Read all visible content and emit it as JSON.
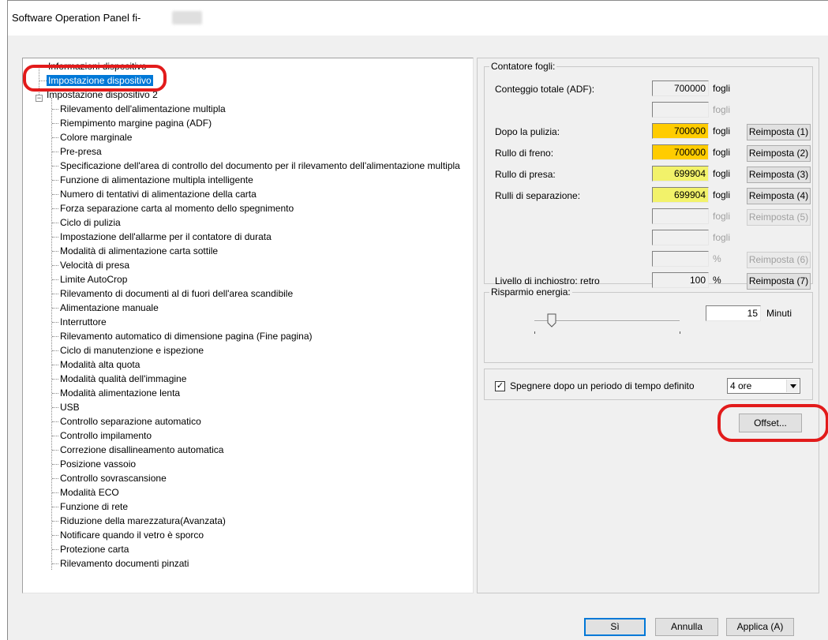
{
  "window": {
    "title": "Software Operation Panel fi-"
  },
  "tree": {
    "root_items": [
      {
        "label": "Informazioni dispositivo",
        "selected": false
      },
      {
        "label": "Impostazione dispositivo",
        "selected": true
      },
      {
        "label": "Impostazione dispositivo 2",
        "selected": false,
        "expander": "−"
      }
    ],
    "children": [
      "Rilevamento dell'alimentazione multipla",
      "Riempimento margine pagina (ADF)",
      "Colore marginale",
      "Pre-presa",
      "Specificazione dell'area di controllo del documento per il rilevamento dell'alimentazione multipla",
      "Funzione di alimentazione multipla intelligente",
      "Numero di tentativi di alimentazione della carta",
      "Forza separazione carta al momento dello spegnimento",
      "Ciclo di pulizia",
      "Impostazione dell'allarme per il contatore di durata",
      "Modalità di alimentazione carta sottile",
      "Velocità di presa",
      "Limite AutoCrop",
      "Rilevamento di documenti al di fuori dell'area scandibile",
      "Alimentazione manuale",
      "Interruttore",
      "Rilevamento automatico di dimensione pagina (Fine pagina)",
      "Ciclo di manutenzione e ispezione",
      "Modalità alta quota",
      "Modalità qualità dell'immagine",
      "Modalità alimentazione lenta",
      "USB",
      "Controllo separazione automatico",
      "Controllo impilamento",
      "Correzione disallineamento automatica",
      "Posizione vassoio",
      "Controllo sovrascansione",
      "Modalità ECO",
      "Funzione di rete",
      "Riduzione della marezzatura(Avanzata)",
      "Notificare quando il vetro è sporco",
      "Protezione carta",
      "Rilevamento documenti pinzati"
    ]
  },
  "counter": {
    "legend": "Contatore fogli:",
    "rows": [
      {
        "label": "Conteggio totale (ADF):",
        "value": "700000",
        "unit": "fogli",
        "button": "",
        "color": "#f0f0f0",
        "unit_disabled": false,
        "btn_disabled": false
      },
      {
        "label": "",
        "value": "",
        "unit": "fogli",
        "button": "",
        "color": "#f0f0f0",
        "unit_disabled": true,
        "btn_disabled": false
      },
      {
        "label": "Dopo la pulizia:",
        "value": "700000",
        "unit": "fogli",
        "button": "Reimposta (1)",
        "color": "#ffcc00",
        "unit_disabled": false,
        "btn_disabled": false
      },
      {
        "label": "Rullo di freno:",
        "value": "700000",
        "unit": "fogli",
        "button": "Reimposta (2)",
        "color": "#ffcc00",
        "unit_disabled": false,
        "btn_disabled": false
      },
      {
        "label": "Rullo di presa:",
        "value": "699904",
        "unit": "fogli",
        "button": "Reimposta (3)",
        "color": "#f2f26a",
        "unit_disabled": false,
        "btn_disabled": false
      },
      {
        "label": "Rulli di separazione:",
        "value": "699904",
        "unit": "fogli",
        "button": "Reimposta (4)",
        "color": "#f2f26a",
        "unit_disabled": false,
        "btn_disabled": false
      },
      {
        "label": "",
        "value": "",
        "unit": "fogli",
        "button": "Reimposta (5)",
        "color": "#f0f0f0",
        "unit_disabled": true,
        "btn_disabled": true
      },
      {
        "label": "",
        "value": "",
        "unit": "fogli",
        "button": "",
        "color": "#f0f0f0",
        "unit_disabled": true,
        "btn_disabled": false
      },
      {
        "label": "",
        "value": "",
        "unit": "%",
        "button": "Reimposta (6)",
        "color": "#f0f0f0",
        "unit_disabled": true,
        "btn_disabled": true
      },
      {
        "label": "Livello di inchiostro: retro",
        "value": "100",
        "unit": "%",
        "button": "Reimposta (7)",
        "color": "#f0f0f0",
        "unit_disabled": false,
        "btn_disabled": false
      }
    ]
  },
  "energy": {
    "legend": "Risparmio energia:",
    "value": "15",
    "unit": "Minuti"
  },
  "shutdown": {
    "checked": true,
    "check_mark": "✓",
    "label": "Spegnere dopo un periodo di tempo definito",
    "selected": "4 ore"
  },
  "offset_button": "Offset...",
  "footer": {
    "ok": "Sì",
    "cancel": "Annulla",
    "apply": "Applica (A)"
  },
  "accent_colors": {
    "highlight": "#e21b1b",
    "selection": "#0078d7"
  }
}
